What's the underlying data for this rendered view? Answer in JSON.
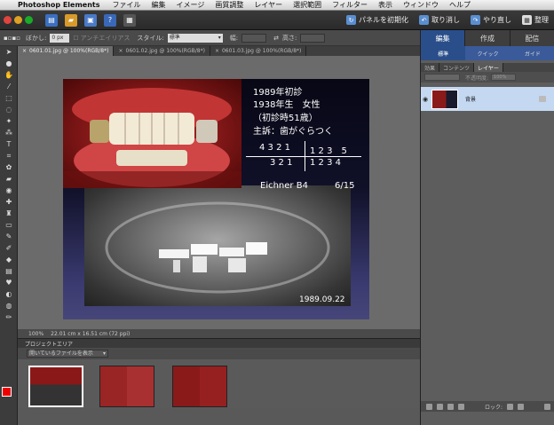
{
  "menubar": {
    "apple": "",
    "app_name": "Photoshop Elements",
    "items": [
      "ファイル",
      "編集",
      "イメージ",
      "画質調整",
      "レイヤー",
      "選択範囲",
      "フィルター",
      "表示",
      "ウィンドウ",
      "ヘルプ"
    ]
  },
  "toolbar": {
    "reset_panels": "パネルを初期化",
    "undo": "取り消し",
    "redo": "やり直し",
    "organizer": "整理"
  },
  "options_bar": {
    "feather_label": "ぼかし:",
    "feather_value": "0 px",
    "antialias_label": "アンチエイリアス",
    "style_label": "スタイル:",
    "style_value": "標準",
    "width_label": "幅:",
    "height_label": "高さ:"
  },
  "doc_tabs": [
    {
      "label": "0601.01.jpg @ 100%(RGB/8*)",
      "active": true
    },
    {
      "label": "0601.02.jpg @ 100%(RGB/8*)",
      "active": false
    },
    {
      "label": "0601.03.jpg @ 100%(RGB/8*)",
      "active": false
    }
  ],
  "slide": {
    "line1": "1989年初診",
    "line2": "1938年生　女性",
    "line3": "（初診時51歳）",
    "line4": "主訴：歯がぐらつく",
    "teeth_upper_left": "4 3 2 1",
    "teeth_upper_right": "1 2 3　5",
    "teeth_lower_left": "3 2 1",
    "teeth_lower_right": "1 2 3 4",
    "eichner": "Eichner B4",
    "ratio": "6/15",
    "date": "1989.09.22"
  },
  "status": {
    "zoom": "100%",
    "dimensions": "22.01 cm x 16.51 cm (72 ppi)"
  },
  "project_bin": {
    "title": "プロジェクトエリア",
    "show_files": "開いているファイルを表示"
  },
  "right_panel": {
    "mode_tabs": [
      "編集",
      "作成",
      "配信"
    ],
    "sub_tabs": [
      "標準",
      "クイック",
      "ガイド"
    ],
    "panel_tabs": [
      "効果",
      "コンテンツ",
      "レイヤー"
    ],
    "blend_mode": "",
    "opacity_label": "不透明度:",
    "opacity_value": "100%",
    "layer_name": "背景",
    "lock_label": "ロック:"
  }
}
